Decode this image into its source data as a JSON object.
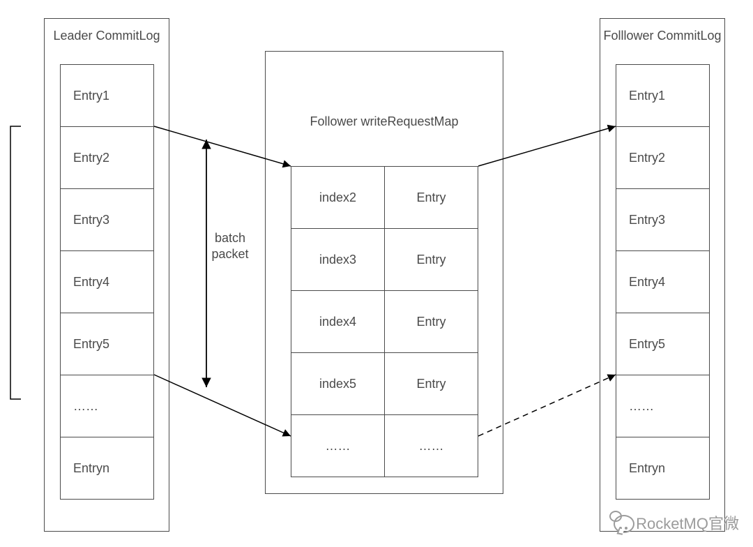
{
  "leader": {
    "title": "Leader CommitLog",
    "entries": [
      "Entry1",
      "Entry2",
      "Entry3",
      "Entry4",
      "Entry5",
      "……",
      "Entryn"
    ]
  },
  "middle": {
    "title": "Follower writeRequestMap",
    "rows": [
      {
        "index": "index2",
        "entry": "Entry"
      },
      {
        "index": "index3",
        "entry": "Entry"
      },
      {
        "index": "index4",
        "entry": "Entry"
      },
      {
        "index": "index5",
        "entry": "Entry"
      },
      {
        "index": "……",
        "entry": "……"
      }
    ]
  },
  "follower": {
    "title": "Folllower CommitLog",
    "entries": [
      "Entry1",
      "Entry2",
      "Entry3",
      "Entry4",
      "Entry5",
      "……",
      "Entryn"
    ]
  },
  "batch_label_line1": "batch",
  "batch_label_line2": "packet",
  "watermark": "RocketMQ官微"
}
